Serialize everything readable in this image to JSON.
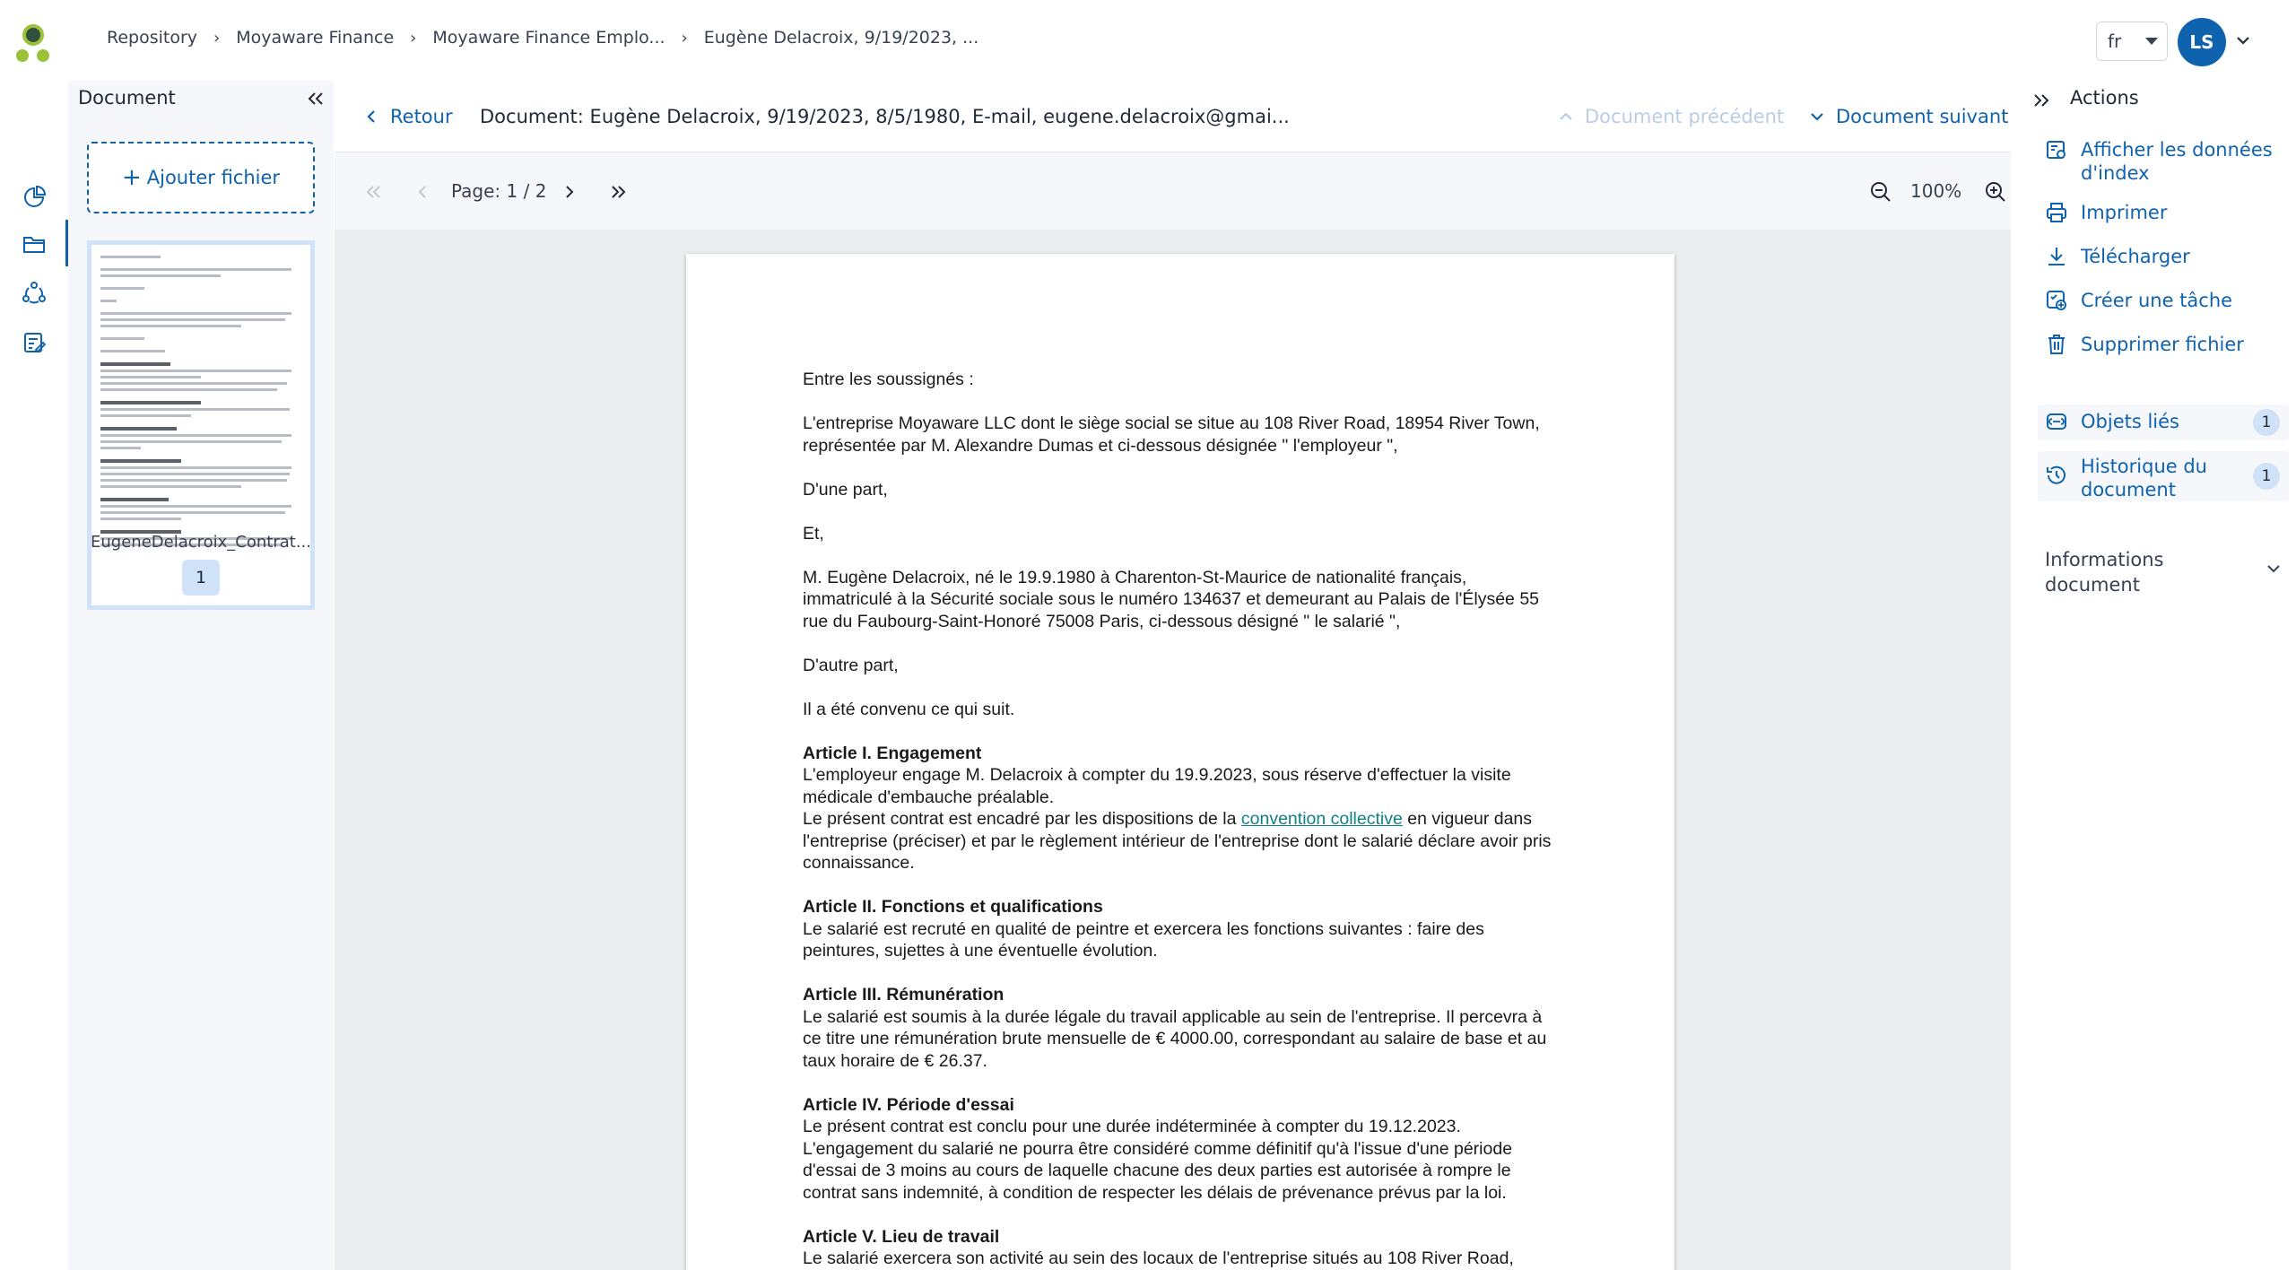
{
  "breadcrumb": {
    "items": [
      "Repository",
      "Moyaware Finance",
      "Moyaware Finance Emplo...",
      "Eugène Delacroix, 9/19/2023, ..."
    ]
  },
  "header": {
    "language": "fr",
    "avatar_initials": "LS"
  },
  "document_panel": {
    "title": "Document",
    "add_file_label": "Ajouter fichier",
    "thumbnail_name": "EugeneDelacroix_Contrat...",
    "thumbnail_page": "1"
  },
  "doc_header": {
    "back_label": "Retour",
    "title": "Document: Eugène Delacroix, 9/19/2023, 8/5/1980, E-mail, eugene.delacroix@gmai...",
    "prev_label": "Document précédent",
    "next_label": "Document suivant"
  },
  "viewer": {
    "page_indicator": "Page: 1 / 2",
    "zoom": "100%"
  },
  "document_content": {
    "intro": "Entre les soussignés :",
    "employer": "L'entreprise Moyaware LLC dont le siège social se situe au 108 River Road, 18954 River Town, représentée par M. Alexandre Dumas et ci-dessous désignée \" l'employeur \",",
    "part1": "D'une part,",
    "and": "Et,",
    "employee": "M. Eugène Delacroix, né le 19.9.1980 à Charenton-St-Maurice de nationalité français, immatriculé à la Sécurité sociale sous le numéro 134637 et demeurant au Palais de l'Élysée 55 rue du Faubourg-Saint-Honoré 75008 Paris, ci-dessous désigné \" le salarié \",",
    "part2": "D'autre part,",
    "agreed": "Il a été convenu ce qui suit.",
    "art1_title": "Article I. Engagement",
    "art1_text_a": "L'employeur engage M. Delacroix à compter du 19.9.2023, sous réserve d'effectuer la visite médicale d'embauche préalable.",
    "art1_text_b": "Le présent contrat est encadré par les dispositions de la",
    "art1_link": "convention collective",
    "art1_text_c": "en vigueur dans l'entreprise (préciser) et par le règlement intérieur de l'entreprise dont le salarié déclare avoir pris connaissance.",
    "art2_title": "Article II. Fonctions et qualifications",
    "art2_text": "Le salarié est recruté en qualité de peintre et exercera les fonctions suivantes : faire des peintures, sujettes à une éventuelle évolution.",
    "art3_title": "Article III. Rémunération",
    "art3_text": "Le salarié est soumis à la durée légale du travail applicable au sein de l'entreprise. Il percevra à ce titre une rémunération brute mensuelle de € 4000.00, correspondant au salaire de base et au taux horaire de € 26.37.",
    "art4_title": "Article IV. Période d'essai",
    "art4_text": "Le présent contrat est conclu pour une durée indéterminée à compter du 19.12.2023. L'engagement du salarié ne pourra être considéré comme définitif qu'à l'issue d'une période d'essai de 3 moins au cours de laquelle chacune des deux parties est autorisée à rompre le contrat sans indemnité, à condition de respecter les délais de prévenance prévus par la loi.",
    "art5_title": "Article V. Lieu de travail",
    "art5_text": "Le salarié exercera son activité au sein des locaux de l'entreprise situés au 108 River Road,"
  },
  "actions": {
    "title": "Actions",
    "items": [
      {
        "label": "Afficher les données d'index",
        "icon": "index-data-icon"
      },
      {
        "label": "Imprimer",
        "icon": "print-icon"
      },
      {
        "label": "Télécharger",
        "icon": "download-icon"
      },
      {
        "label": "Créer une tâche",
        "icon": "create-task-icon"
      },
      {
        "label": "Supprimer fichier",
        "icon": "trash-icon"
      }
    ],
    "linked_objects": {
      "label": "Objets liés",
      "count": "1"
    },
    "history": {
      "label": "Historique du document",
      "count": "1"
    },
    "info_label": "Informations document"
  },
  "colors": {
    "accent": "#0f62ae",
    "panel_bg": "#f5f7fa",
    "viewer_bg": "#ebecee",
    "badge_bg": "#cfe2f7"
  }
}
